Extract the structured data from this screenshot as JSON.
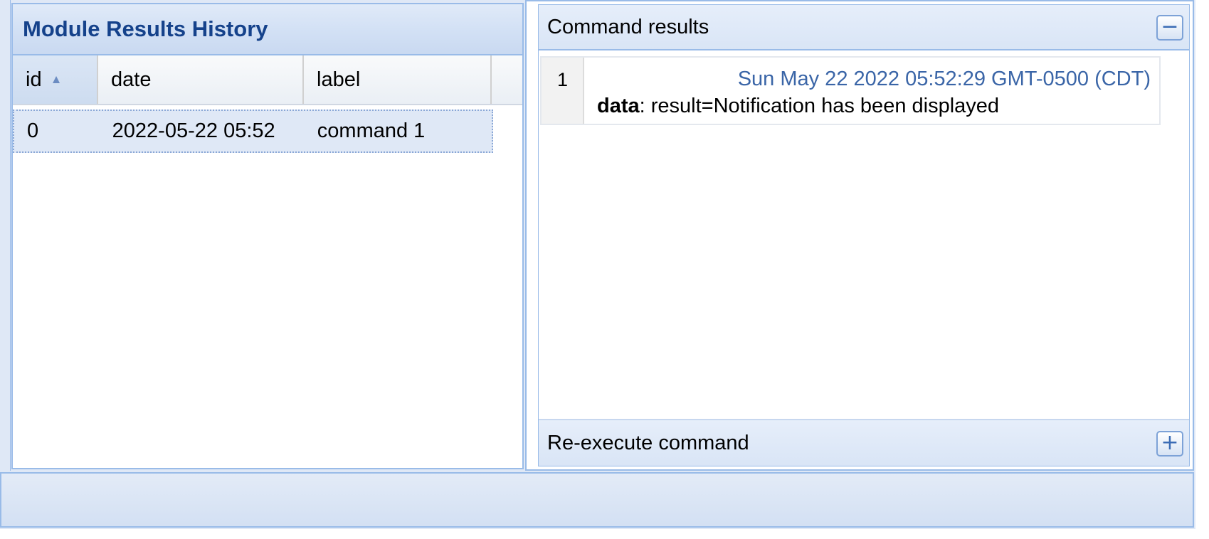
{
  "history_panel": {
    "title": "Module Results History",
    "columns": [
      "id",
      "date",
      "label"
    ],
    "sort_indicator": "▲",
    "rows": [
      {
        "id": "0",
        "date": "2022-05-22 05:52",
        "label": "command 1"
      }
    ]
  },
  "command_results_panel": {
    "title": "Command results",
    "collapse_symbol": "−",
    "results": [
      {
        "index": "1",
        "date": "Sun May 22 2022 05:52:29 GMT-0500 (CDT)",
        "data_key": "data",
        "data_value": ": result=Notification has been displayed"
      }
    ]
  },
  "reexecute_panel": {
    "title": "Re-execute command",
    "expand_symbol": "+"
  },
  "colors": {
    "accent": "#15428b",
    "border": "#99bbe8",
    "selected_row": "#dfe8f6",
    "result_date": "#3a65a7"
  }
}
